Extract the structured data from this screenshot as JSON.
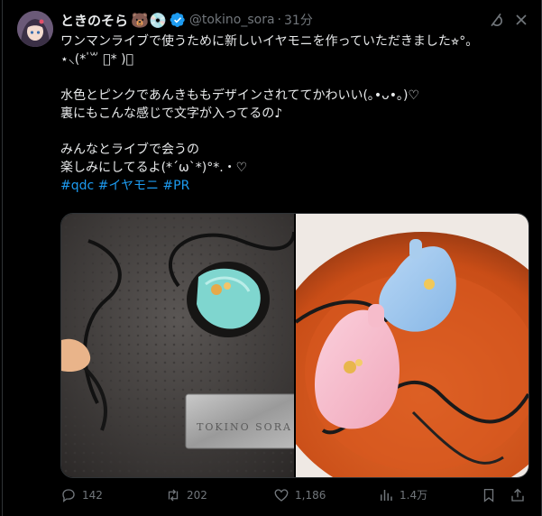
{
  "tweet": {
    "author_name": "ときのそら",
    "author_badges": "🐻💿",
    "handle": "@tokino_sora",
    "separator": "·",
    "time": "31分",
    "lines": [
      "ワンマンライブで使うために新しいイヤモニを作っていただきました⭐︎°。",
      "⋆⸜(* ॑꒳ ॑* )⸝",
      "",
      "水色とピンクであんきももデザインされててかわいい(｡•ᴗ•｡)♡",
      "裏にもこんな感じで文字が入ってるの♪",
      "",
      "みんなとライブで会うの",
      "楽しみにしてるよ(*´ω`*)°*.・♡"
    ],
    "hashtags": "#qdc #イヤモニ #PR",
    "plate_text": "TOKINO SORA"
  },
  "actions": {
    "replies": "142",
    "reposts": "202",
    "likes": "1,186",
    "views": "1.4万"
  },
  "colors": {
    "accent": "#1d9bf0",
    "muted": "#71767b",
    "text": "#e7e9ea"
  }
}
